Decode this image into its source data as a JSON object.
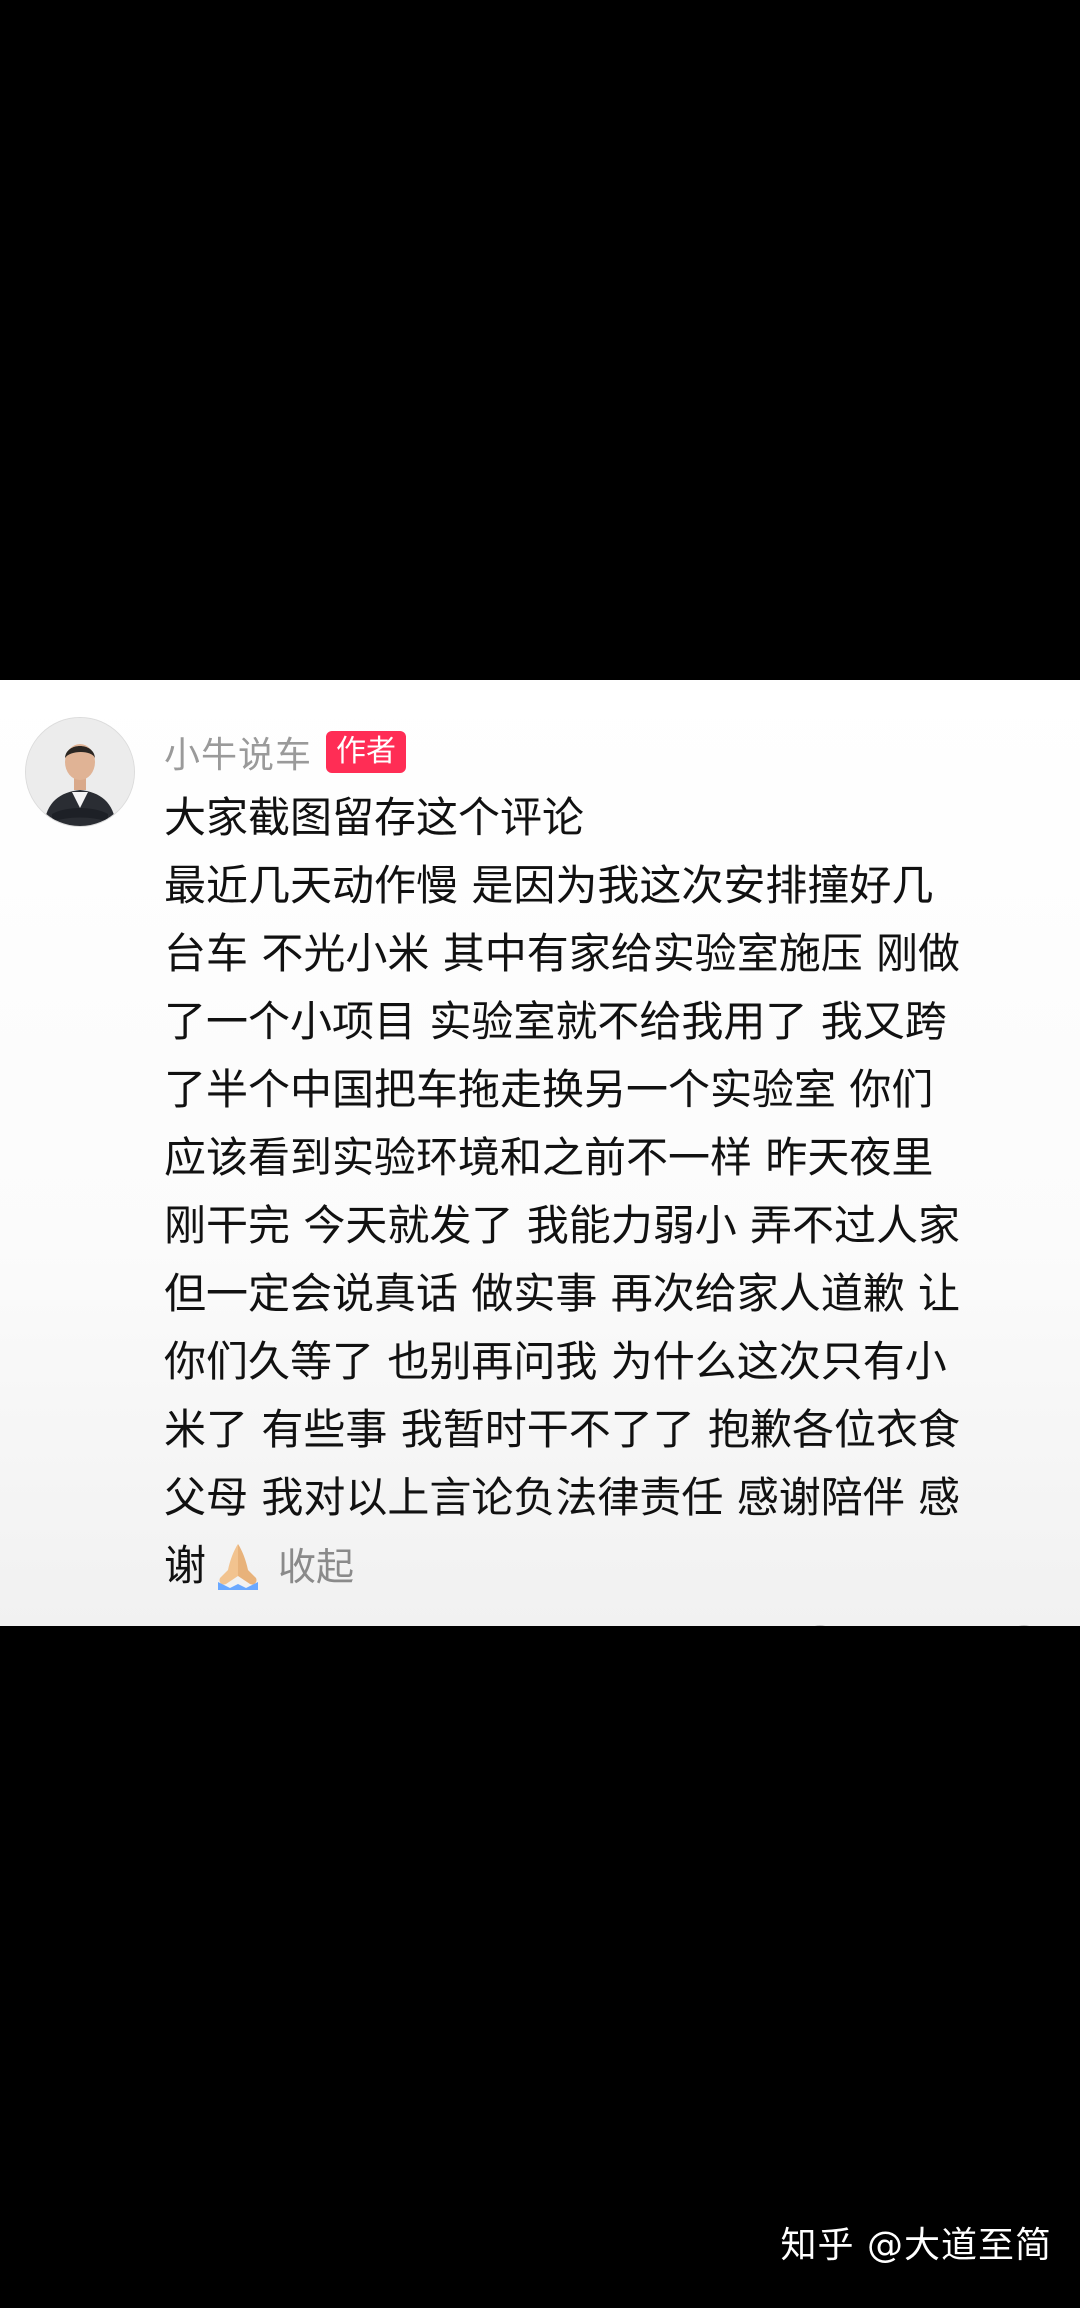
{
  "comment": {
    "author_name": "小牛说车",
    "author_badge": "作者",
    "lines": [
      "大家截图留存这个评论",
      "最近几天动作慢 是因为我这次安排撞好几",
      "台车 不光小米 其中有家给实验室施压 刚做",
      "了一个小项目 实验室就不给我用了 我又跨",
      "了半个中国把车拖走换另一个实验室 你们",
      "应该看到实验环境和之前不一样 昨天夜里",
      "刚干完 今天就发了 我能力弱小 弄不过人家",
      "但一定会说真话 做实事 再次给家人道歉 让",
      "你们久等了 也别再问我 为什么这次只有小",
      "米了 有些事 我暂时干不了了 抱歉各位衣食",
      "父母 我对以上言论负法律责任 感谢陪伴 感"
    ],
    "last_line_text": "谢",
    "emoji": "folded-hands-emoji",
    "collapse_label": "收起"
  },
  "watermark": {
    "text": "知乎 @大道至简"
  },
  "colors": {
    "badge": "#ff2d55",
    "author_name": "#9a9a9a",
    "body_text": "#111111",
    "background": "#000000"
  }
}
